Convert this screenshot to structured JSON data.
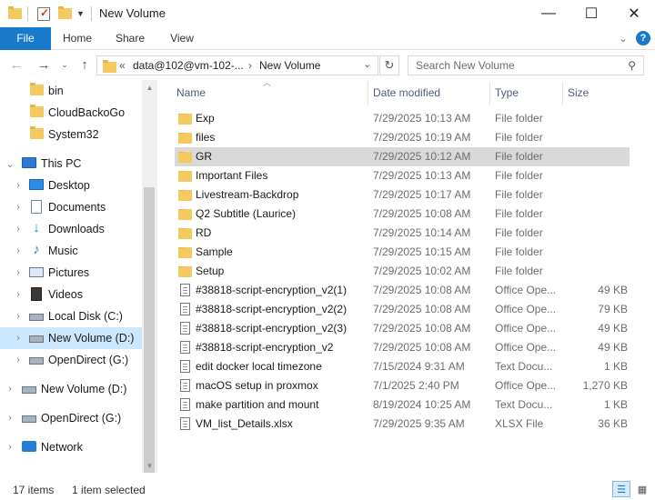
{
  "window": {
    "title": "New Volume",
    "controls": {
      "minimize": "—",
      "maximize": "☐",
      "close": "✕"
    }
  },
  "ribbon": {
    "tabs": [
      "File",
      "Home",
      "Share",
      "View"
    ],
    "expand_icon": "chevron-down",
    "help_icon": "?"
  },
  "address": {
    "overflow": "«",
    "crumbs": [
      "data@102@vm-102-...",
      "New Volume"
    ],
    "separator": "›"
  },
  "search": {
    "placeholder": "Search New Volume"
  },
  "nav": {
    "items": [
      {
        "label": "bin",
        "icon": "folder",
        "chevron": ""
      },
      {
        "label": "CloudBackoGo",
        "icon": "folder",
        "chevron": ""
      },
      {
        "label": "System32",
        "icon": "folder",
        "chevron": ""
      },
      {
        "label": "This PC",
        "icon": "pc",
        "chevron": "expanded"
      },
      {
        "label": "Desktop",
        "icon": "desktop",
        "chevron": "collapsed"
      },
      {
        "label": "Documents",
        "icon": "documents",
        "chevron": "collapsed"
      },
      {
        "label": "Downloads",
        "icon": "downloads",
        "chevron": "collapsed"
      },
      {
        "label": "Music",
        "icon": "music",
        "chevron": "collapsed"
      },
      {
        "label": "Pictures",
        "icon": "pictures",
        "chevron": "collapsed"
      },
      {
        "label": "Videos",
        "icon": "videos",
        "chevron": "collapsed"
      },
      {
        "label": "Local Disk (C:)",
        "icon": "drive",
        "chevron": "collapsed"
      },
      {
        "label": "New Volume (D:)",
        "icon": "drive",
        "chevron": "collapsed",
        "selected": true
      },
      {
        "label": "OpenDirect (G:)",
        "icon": "drive",
        "chevron": "collapsed"
      },
      {
        "label": "New Volume (D:)",
        "icon": "drive",
        "chevron": "collapsed"
      },
      {
        "label": "OpenDirect (G:)",
        "icon": "drive",
        "chevron": "collapsed"
      },
      {
        "label": "Network",
        "icon": "network",
        "chevron": "collapsed"
      }
    ]
  },
  "columns": {
    "name": "Name",
    "date": "Date modified",
    "type": "Type",
    "size": "Size"
  },
  "files": [
    {
      "name": "Exp",
      "date": "7/29/2025 10:13 AM",
      "type": "File folder",
      "size": "",
      "kind": "folder"
    },
    {
      "name": "files",
      "date": "7/29/2025 10:19 AM",
      "type": "File folder",
      "size": "",
      "kind": "folder"
    },
    {
      "name": "GR",
      "date": "7/29/2025 10:12 AM",
      "type": "File folder",
      "size": "",
      "kind": "folder",
      "selected": true
    },
    {
      "name": "Important Files",
      "date": "7/29/2025 10:13 AM",
      "type": "File folder",
      "size": "",
      "kind": "folder"
    },
    {
      "name": "Livestream-Backdrop",
      "date": "7/29/2025 10:17 AM",
      "type": "File folder",
      "size": "",
      "kind": "folder"
    },
    {
      "name": "Q2 Subtitle (Laurice)",
      "date": "7/29/2025 10:08 AM",
      "type": "File folder",
      "size": "",
      "kind": "folder"
    },
    {
      "name": "RD",
      "date": "7/29/2025 10:14 AM",
      "type": "File folder",
      "size": "",
      "kind": "folder"
    },
    {
      "name": "Sample",
      "date": "7/29/2025 10:15 AM",
      "type": "File folder",
      "size": "",
      "kind": "folder"
    },
    {
      "name": "Setup",
      "date": "7/29/2025 10:02 AM",
      "type": "File folder",
      "size": "",
      "kind": "folder"
    },
    {
      "name": "#38818-script-encryption_v2(1)",
      "date": "7/29/2025 10:08 AM",
      "type": "Office Ope...",
      "size": "49 KB",
      "kind": "file"
    },
    {
      "name": "#38818-script-encryption_v2(2)",
      "date": "7/29/2025 10:08 AM",
      "type": "Office Ope...",
      "size": "79 KB",
      "kind": "file"
    },
    {
      "name": "#38818-script-encryption_v2(3)",
      "date": "7/29/2025 10:08 AM",
      "type": "Office Ope...",
      "size": "49 KB",
      "kind": "file"
    },
    {
      "name": "#38818-script-encryption_v2",
      "date": "7/29/2025 10:08 AM",
      "type": "Office Ope...",
      "size": "49 KB",
      "kind": "file"
    },
    {
      "name": "edit docker local timezone",
      "date": "7/15/2024 9:31 AM",
      "type": "Text Docu...",
      "size": "1 KB",
      "kind": "file"
    },
    {
      "name": "macOS setup in proxmox",
      "date": "7/1/2025 2:40 PM",
      "type": "Office Ope...",
      "size": "1,270 KB",
      "kind": "file"
    },
    {
      "name": "make partition and mount",
      "date": "8/19/2024 10:25 AM",
      "type": "Text Docu...",
      "size": "1 KB",
      "kind": "file"
    },
    {
      "name": "VM_list_Details.xlsx",
      "date": "7/29/2025 9:35 AM",
      "type": "XLSX File",
      "size": "36 KB",
      "kind": "file"
    }
  ],
  "status": {
    "count": "17 items",
    "selection": "1 item selected"
  },
  "colors": {
    "accent": "#1979ca",
    "selected_nav": "#cce8ff",
    "selected_row": "#d9d9d9",
    "folder": "#f4c95d"
  }
}
